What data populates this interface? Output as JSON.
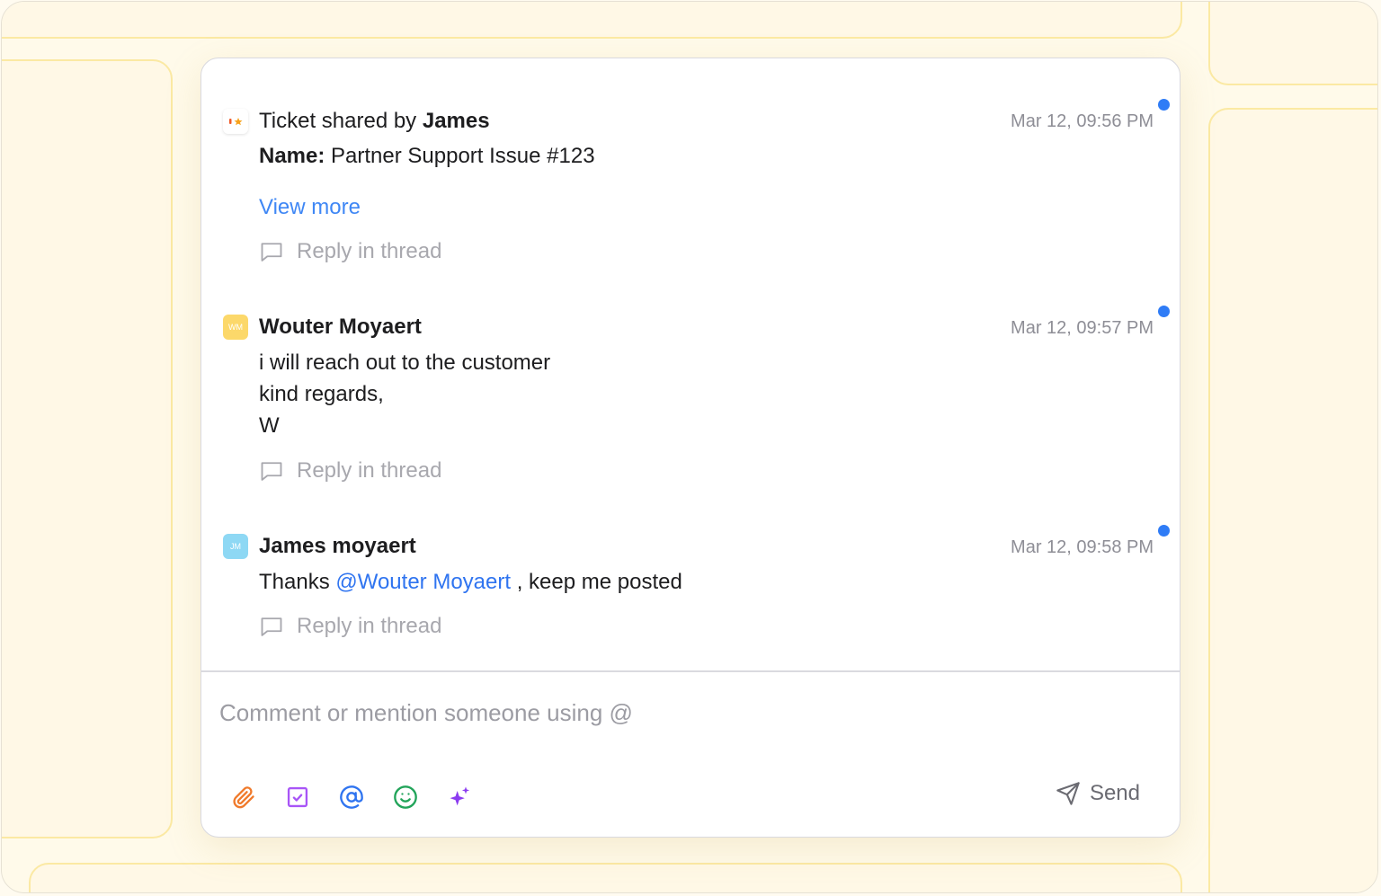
{
  "messages": [
    {
      "type": "ticket",
      "prefix": "Ticket shared by",
      "author": "James",
      "timestamp": "Mar 12, 09:56 PM",
      "name_label": "Name:",
      "name_value": "Partner Support Issue #123",
      "view_more": "View more",
      "reply_label": "Reply in thread",
      "unread": true
    },
    {
      "type": "comment",
      "author": "Wouter Moyaert",
      "initials": "WM",
      "timestamp": "Mar 12, 09:57 PM",
      "lines": [
        "i will reach out to the customer",
        "kind regards,",
        "W"
      ],
      "reply_label": "Reply in thread",
      "unread": true
    },
    {
      "type": "comment",
      "author": "James moyaert",
      "initials": "JM",
      "timestamp": "Mar 12, 09:58 PM",
      "text_before": "Thanks",
      "mention": "@Wouter Moyaert",
      "text_after": ", keep me posted",
      "reply_label": "Reply in thread",
      "unread": true
    }
  ],
  "composer": {
    "placeholder": "Comment or mention someone using @",
    "send_label": "Send",
    "toolbar_icons": [
      "paperclip-icon",
      "checkbox-icon",
      "at-sign-icon",
      "smiley-icon",
      "sparkles-icon"
    ]
  },
  "colors": {
    "accent_blue": "#2f7cf6",
    "link_blue": "#3f87f5",
    "paperclip": "#f07a2b",
    "checkbox": "#a855f7",
    "at_sign": "#2f74f0",
    "smiley": "#22a45a",
    "sparkles": "#8b3cf0"
  }
}
